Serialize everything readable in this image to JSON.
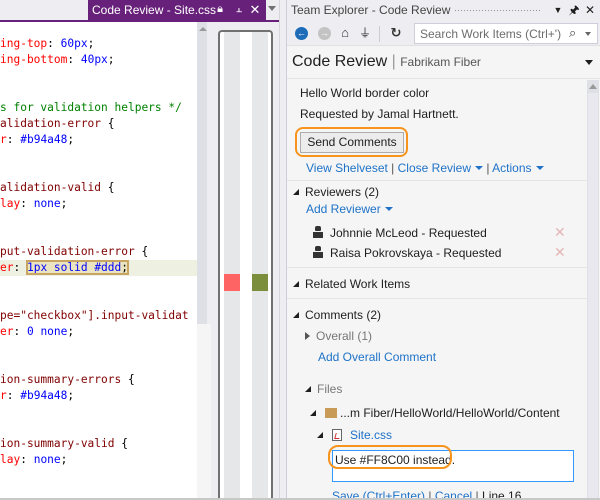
{
  "editor": {
    "tab_title": "Code Review - Site.css",
    "tab_icons": [
      "lock-icon",
      "pin-icon",
      "close-icon"
    ],
    "code_lines": [
      {
        "parts": [
          {
            "t": "ing-top",
            "c": "prop"
          },
          {
            "t": ": ",
            "c": "punc"
          },
          {
            "t": "60px",
            "c": "val"
          },
          {
            "t": ";",
            "c": "punc"
          }
        ]
      },
      {
        "parts": [
          {
            "t": "ing-bottom",
            "c": "prop"
          },
          {
            "t": ": ",
            "c": "punc"
          },
          {
            "t": "40px",
            "c": "val"
          },
          {
            "t": ";",
            "c": "punc"
          }
        ]
      },
      {
        "parts": []
      },
      {
        "parts": []
      },
      {
        "parts": [
          {
            "t": "s for validation helpers */",
            "c": "com"
          }
        ]
      },
      {
        "parts": [
          {
            "t": "alidation-error ",
            "c": "sel"
          },
          {
            "t": "{",
            "c": "punc"
          }
        ]
      },
      {
        "parts": [
          {
            "t": "r",
            "c": "prop"
          },
          {
            "t": ": ",
            "c": "punc"
          },
          {
            "t": "#b94a48",
            "c": "val"
          },
          {
            "t": ";",
            "c": "punc"
          }
        ]
      },
      {
        "parts": []
      },
      {
        "parts": []
      },
      {
        "parts": [
          {
            "t": "alidation-valid ",
            "c": "sel"
          },
          {
            "t": "{",
            "c": "punc"
          }
        ]
      },
      {
        "parts": [
          {
            "t": "lay",
            "c": "prop"
          },
          {
            "t": ": ",
            "c": "punc"
          },
          {
            "t": "none",
            "c": "val"
          },
          {
            "t": ";",
            "c": "punc"
          }
        ]
      },
      {
        "parts": []
      },
      {
        "parts": []
      },
      {
        "parts": [
          {
            "t": "put-validation-error ",
            "c": "sel"
          },
          {
            "t": "{",
            "c": "punc"
          }
        ]
      },
      {
        "parts": [
          {
            "t": "er",
            "c": "prop"
          },
          {
            "t": ": ",
            "c": "punc"
          },
          {
            "t": "1px solid #ddd",
            "c": "val",
            "hl": true
          },
          {
            "t": ";",
            "c": "punc",
            "hl": true
          }
        ]
      },
      {
        "parts": []
      },
      {
        "parts": []
      },
      {
        "parts": [
          {
            "t": "pe=\"checkbox\"].input-validat",
            "c": "sel"
          }
        ]
      },
      {
        "parts": [
          {
            "t": "er",
            "c": "prop"
          },
          {
            "t": ": ",
            "c": "punc"
          },
          {
            "t": "0 none",
            "c": "val"
          },
          {
            "t": ";",
            "c": "punc"
          }
        ]
      },
      {
        "parts": []
      },
      {
        "parts": []
      },
      {
        "parts": [
          {
            "t": "ion-summary-errors ",
            "c": "sel"
          },
          {
            "t": "{",
            "c": "punc"
          }
        ]
      },
      {
        "parts": [
          {
            "t": "r",
            "c": "prop"
          },
          {
            "t": ": ",
            "c": "punc"
          },
          {
            "t": "#b94a48",
            "c": "val"
          },
          {
            "t": ";",
            "c": "punc"
          }
        ]
      },
      {
        "parts": []
      },
      {
        "parts": []
      },
      {
        "parts": [
          {
            "t": "ion-summary-valid ",
            "c": "sel"
          },
          {
            "t": "{",
            "c": "punc"
          }
        ]
      },
      {
        "parts": [
          {
            "t": "lay",
            "c": "prop"
          },
          {
            "t": ": ",
            "c": "punc"
          },
          {
            "t": "none",
            "c": "val"
          },
          {
            "t": ";",
            "c": "punc"
          }
        ]
      }
    ],
    "diff_markers": {
      "removed_color": "#ff6464",
      "added_color": "#7a8e3c"
    }
  },
  "team_explorer": {
    "window_title": "Team Explorer - Code Review",
    "toolbar": {
      "back": "back-icon",
      "forward": "forward-icon",
      "home": "home-icon",
      "connect": "plug-icon",
      "refresh": "refresh-icon",
      "search_placeholder": "Search Work Items (Ctrl+')"
    },
    "header": {
      "title": "Code Review",
      "separator": "|",
      "project": "Fabrikam Fiber"
    },
    "review": {
      "title": "Hello World border color",
      "requested_by": "Requested by Jamal Hartnett.",
      "send_comments": "Send Comments",
      "view_shelveset": "View Shelveset",
      "close_review": "Close Review",
      "actions": "Actions",
      "sep": "|"
    },
    "reviewers": {
      "label": "Reviewers (2)",
      "add_reviewer": "Add Reviewer",
      "items": [
        {
          "name": "Johnnie McLeod - Requested"
        },
        {
          "name": "Raisa Pokrovskaya - Requested"
        }
      ]
    },
    "related_work_items": {
      "label": "Related Work Items"
    },
    "comments": {
      "label": "Comments (2)",
      "overall": "Overall",
      "overall_count": "(1)",
      "add_overall": "Add Overall Comment",
      "files_label": "Files",
      "folder_path": "...m Fiber/HelloWorld/HelloWorld/Content",
      "file_name": "Site.css",
      "comment_text": "Use #FF8C00 instead.",
      "save": "Save (Ctrl+Enter)",
      "cancel": "Cancel",
      "line": "Line 16"
    }
  },
  "colors": {
    "tab_accent": "#68217a",
    "link": "#1e72c8",
    "highlight_ring": "#f7941d"
  }
}
